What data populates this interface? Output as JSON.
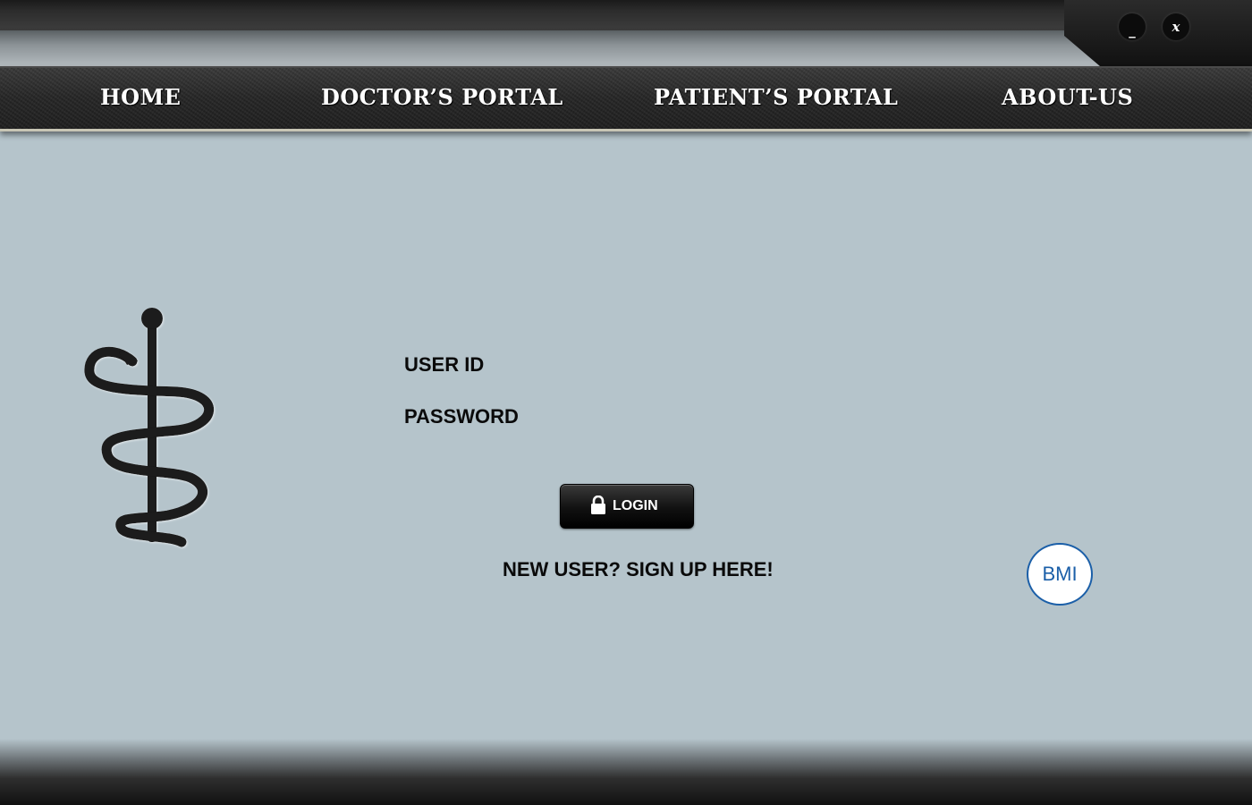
{
  "window": {
    "minimize_label": "_",
    "close_label": "x"
  },
  "nav": {
    "items": [
      {
        "label": "Home"
      },
      {
        "label": "Doctor’s Portal"
      },
      {
        "label": "Patient’s Portal"
      },
      {
        "label": "About-Us"
      }
    ]
  },
  "logo": {
    "icon": "rod-of-asclepius-icon"
  },
  "login_form": {
    "user_id_label": "USER ID",
    "password_label": "PASSWORD",
    "user_id_value": "",
    "password_value": "",
    "login_button_label": "LOGIN",
    "signup_link": "NEW USER? SIGN UP HERE!"
  },
  "bmi_button": {
    "label": "BMI"
  },
  "colors": {
    "background": "#b5c4cb",
    "bmi_accent": "#1b5fa8"
  }
}
